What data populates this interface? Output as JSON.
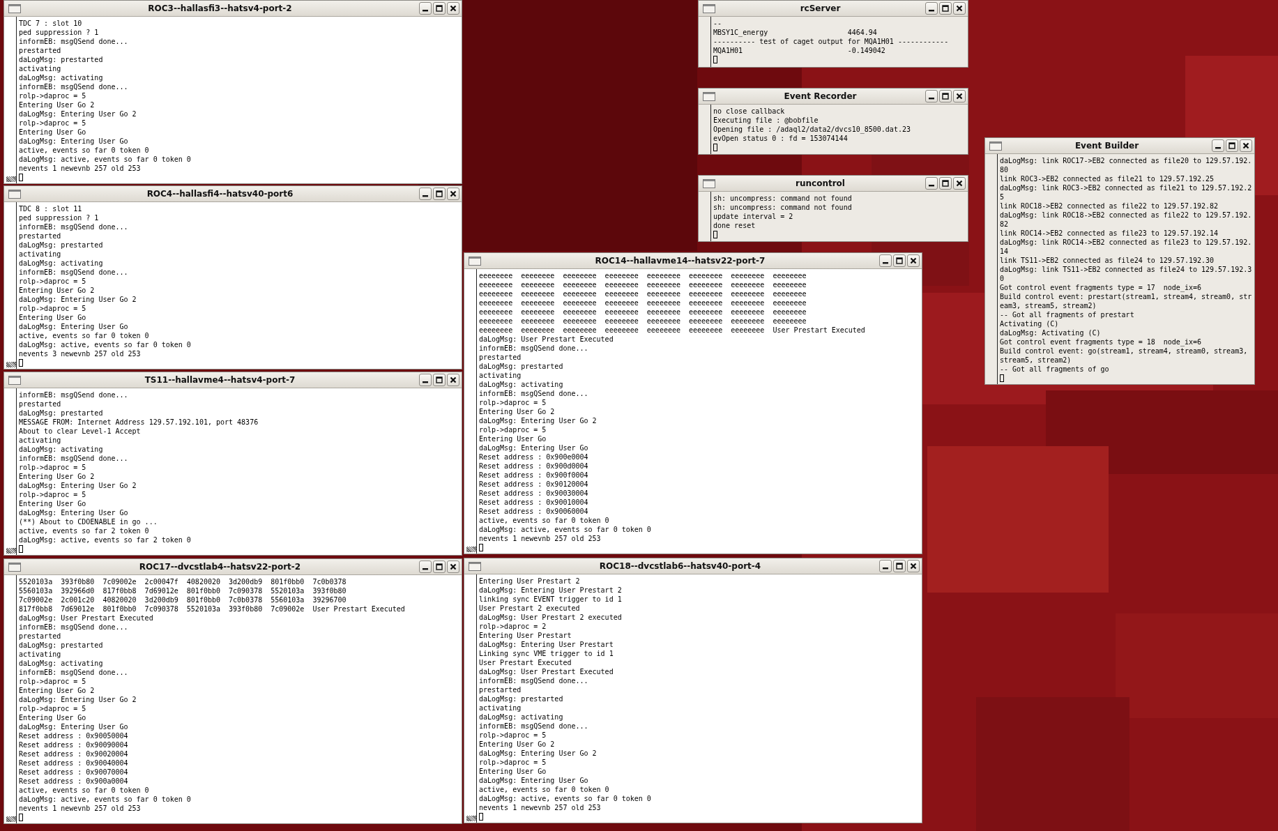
{
  "windows": [
    {
      "title": "ROC3--hallasfi3--hatsv4-port-2",
      "kind": "terminal",
      "lines": [
        "TDC 7 : slot 10",
        "ped suppression ? 1",
        "informEB: msgQSend done...",
        "prestarted",
        "daLogMsg: prestarted",
        "activating",
        "daLogMsg: activating",
        "informEB: msgQSend done...",
        "rolp->daproc = 5",
        "Entering User Go 2",
        "daLogMsg: Entering User Go 2",
        "rolp->daproc = 5",
        "Entering User Go",
        "daLogMsg: Entering User Go",
        "active, events so far 0 token 0",
        "daLogMsg: active, events so far 0 token 0",
        "nevents 1 newevnb 257 old 253"
      ]
    },
    {
      "title": "ROC4--hallasfi4--hatsv40-port6",
      "kind": "terminal",
      "lines": [
        "TDC 8 : slot 11",
        "ped suppression ? 1",
        "informEB: msgQSend done...",
        "prestarted",
        "daLogMsg: prestarted",
        "activating",
        "daLogMsg: activating",
        "informEB: msgQSend done...",
        "rolp->daproc = 5",
        "Entering User Go 2",
        "daLogMsg: Entering User Go 2",
        "rolp->daproc = 5",
        "Entering User Go",
        "daLogMsg: Entering User Go",
        "active, events so far 0 token 0",
        "daLogMsg: active, events so far 0 token 0",
        "nevents 3 newevnb 257 old 253"
      ]
    },
    {
      "title": "TS11--hallavme4--hatsv4-port-7",
      "kind": "terminal",
      "lines": [
        "informEB: msgQSend done...",
        "prestarted",
        "daLogMsg: prestarted",
        "MESSAGE FROM: Internet Address 129.57.192.101, port 48376",
        "About to clear Level-1 Accept",
        "activating",
        "daLogMsg: activating",
        "informEB: msgQSend done...",
        "rolp->daproc = 5",
        "Entering User Go 2",
        "daLogMsg: Entering User Go 2",
        "rolp->daproc = 5",
        "Entering User Go",
        "daLogMsg: Entering User Go",
        "(**) About to CDOENABLE in go ...",
        "active, events so far 2 token 0",
        "daLogMsg: active, events so far 2 token 0"
      ]
    },
    {
      "title": "ROC17--dvcstlab4--hatsv22-port-2",
      "kind": "terminal",
      "lines": [
        "5520103a  393f0b80  7c09002e  2c00047f  40820020  3d200db9  801f0bb0  7c0b0378",
        "5560103a  392966d0  817f0bb8  7d69012e  801f0bb0  7c090378  5520103a  393f0b80",
        "7c09002e  2c001c20  40820020  3d200db9  801f0bb0  7c0b0378  5560103a  39296700",
        "817f0bb8  7d69012e  801f0bb0  7c090378  5520103a  393f0b80  7c09002e  User Prestart Executed",
        "daLogMsg: User Prestart Executed",
        "informEB: msgQSend done...",
        "prestarted",
        "daLogMsg: prestarted",
        "activating",
        "daLogMsg: activating",
        "informEB: msgQSend done...",
        "rolp->daproc = 5",
        "Entering User Go 2",
        "daLogMsg: Entering User Go 2",
        "rolp->daproc = 5",
        "Entering User Go",
        "daLogMsg: Entering User Go",
        "Reset address : 0x90050004",
        "Reset address : 0x90090004",
        "Reset address : 0x90020004",
        "Reset address : 0x90040004",
        "Reset address : 0x90070004",
        "Reset address : 0x900a0004",
        "active, events so far 0 token 0",
        "daLogMsg: active, events so far 0 token 0",
        "nevents 1 newevnb 257 old 253"
      ]
    },
    {
      "title": "rcServer",
      "kind": "panel",
      "lines": [
        "--",
        "MBSY1C_energy                   4464.94",
        "---------- test of caget output for MQA1H01 ------------",
        "MQA1H01                         -0.149042"
      ]
    },
    {
      "title": "Event Recorder",
      "kind": "panel",
      "lines": [
        "no close callback",
        "Executing file : @bobfile",
        "Opening file : /adaql2/data2/dvcs10_8500.dat.23",
        "evOpen status 0 : fd = 153074144"
      ]
    },
    {
      "title": "runcontrol",
      "kind": "panel",
      "lines": [
        "sh: uncompress: command not found",
        "sh: uncompress: command not found",
        "update interval = 2",
        "done reset"
      ]
    },
    {
      "title": "ROC14--hallavme14--hatsv22-port-7",
      "kind": "terminal",
      "lines": [
        "eeeeeeee  eeeeeeee  eeeeeeee  eeeeeeee  eeeeeeee  eeeeeeee  eeeeeeee  eeeeeeee",
        "eeeeeeee  eeeeeeee  eeeeeeee  eeeeeeee  eeeeeeee  eeeeeeee  eeeeeeee  eeeeeeee",
        "eeeeeeee  eeeeeeee  eeeeeeee  eeeeeeee  eeeeeeee  eeeeeeee  eeeeeeee  eeeeeeee",
        "eeeeeeee  eeeeeeee  eeeeeeee  eeeeeeee  eeeeeeee  eeeeeeee  eeeeeeee  eeeeeeee",
        "eeeeeeee  eeeeeeee  eeeeeeee  eeeeeeee  eeeeeeee  eeeeeeee  eeeeeeee  eeeeeeee",
        "eeeeeeee  eeeeeeee  eeeeeeee  eeeeeeee  eeeeeeee  eeeeeeee  eeeeeeee  eeeeeeee",
        "eeeeeeee  eeeeeeee  eeeeeeee  eeeeeeee  eeeeeeee  eeeeeeee  eeeeeeee  User Prestart Executed",
        "daLogMsg: User Prestart Executed",
        "informEB: msgQSend done...",
        "prestarted",
        "daLogMsg: prestarted",
        "activating",
        "daLogMsg: activating",
        "informEB: msgQSend done...",
        "rolp->daproc = 5",
        "Entering User Go 2",
        "daLogMsg: Entering User Go 2",
        "rolp->daproc = 5",
        "Entering User Go",
        "daLogMsg: Entering User Go",
        "Reset address : 0x900e0004",
        "Reset address : 0x900d0004",
        "Reset address : 0x900f0004",
        "Reset address : 0x90120004",
        "Reset address : 0x90030004",
        "Reset address : 0x90010004",
        "Reset address : 0x90060004",
        "active, events so far 0 token 0",
        "daLogMsg: active, events so far 0 token 0",
        "nevents 1 newevnb 257 old 253"
      ]
    },
    {
      "title": "ROC18--dvcstlab6--hatsv40-port-4",
      "kind": "terminal",
      "lines": [
        "Entering User Prestart 2",
        "daLogMsg: Entering User Prestart 2",
        "linking sync EVENT trigger to id 1",
        "User Prestart 2 executed",
        "daLogMsg: User Prestart 2 executed",
        "rolp->daproc = 2",
        "Entering User Prestart",
        "daLogMsg: Entering User Prestart",
        "Linking sync VME trigger to id 1",
        "User Prestart Executed",
        "daLogMsg: User Prestart Executed",
        "informEB: msgQSend done...",
        "prestarted",
        "daLogMsg: prestarted",
        "activating",
        "daLogMsg: activating",
        "informEB: msgQSend done...",
        "rolp->daproc = 5",
        "Entering User Go 2",
        "daLogMsg: Entering User Go 2",
        "rolp->daproc = 5",
        "Entering User Go",
        "daLogMsg: Entering User Go",
        "active, events so far 0 token 0",
        "daLogMsg: active, events so far 0 token 0",
        "nevents 1 newevnb 257 old 253"
      ]
    },
    {
      "title": "Event Builder",
      "kind": "panel",
      "lines": [
        "daLogMsg: link ROC17->EB2 connected as file20 to 129.57.192.80",
        "link ROC3->EB2 connected as file21 to 129.57.192.25",
        "daLogMsg: link ROC3->EB2 connected as file21 to 129.57.192.25",
        "link ROC18->EB2 connected as file22 to 129.57.192.82",
        "daLogMsg: link ROC18->EB2 connected as file22 to 129.57.192.82",
        "link ROC14->EB2 connected as file23 to 129.57.192.14",
        "daLogMsg: link ROC14->EB2 connected as file23 to 129.57.192.14",
        "link TS11->EB2 connected as file24 to 129.57.192.30",
        "daLogMsg: link TS11->EB2 connected as file24 to 129.57.192.30",
        "Got control event fragments type = 17  node_ix=6",
        "Build control event: prestart(stream1, stream4, stream0, stream3, stream5, stream2)",
        "-- Got all fragments of prestart",
        "Activating (C)",
        "daLogMsg: Activating (C)",
        "Got control event fragments type = 18  node_ix=6",
        "Build control event: go(stream1, stream4, stream0, stream3, stream5, stream2)",
        "-- Got all fragments of go"
      ]
    }
  ]
}
